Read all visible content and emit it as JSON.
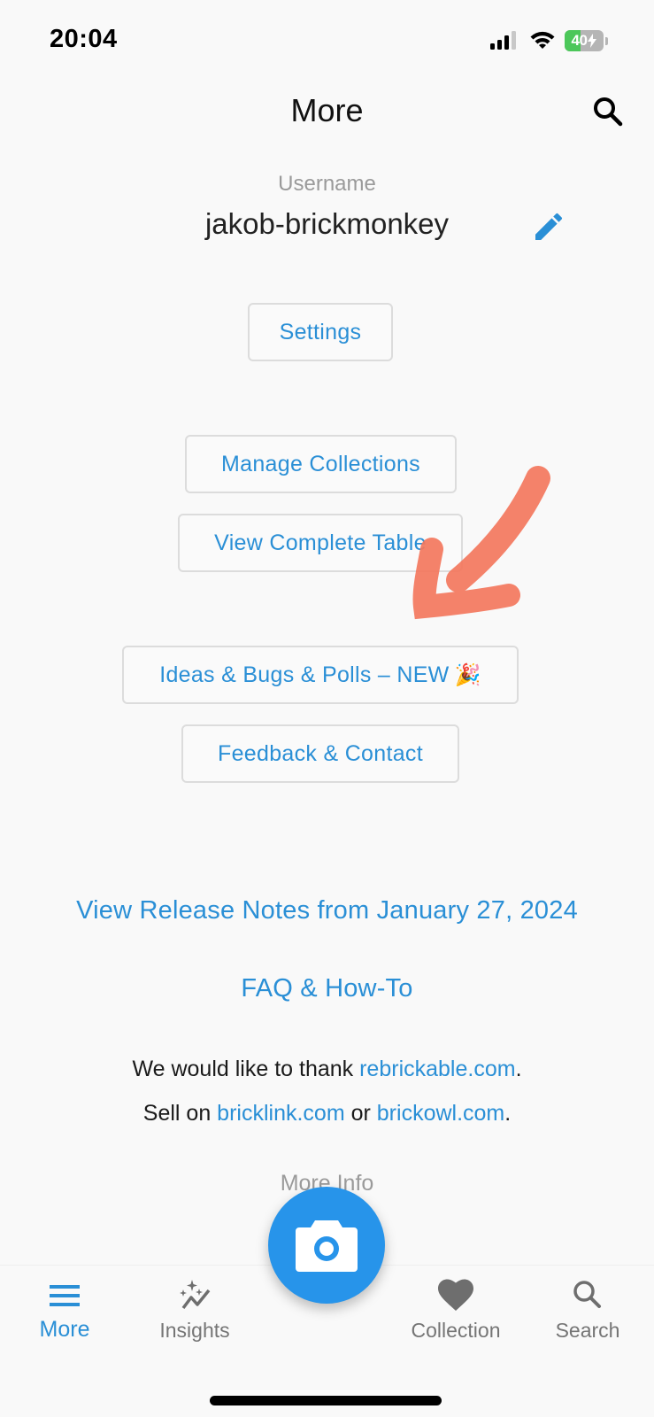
{
  "status_bar": {
    "time": "20:04",
    "battery_percent": "40",
    "battery_level": 0.4,
    "charging": true,
    "icons": [
      "cellular-signal-icon",
      "wifi-icon",
      "battery-icon"
    ]
  },
  "nav": {
    "title": "More",
    "search_icon": "search-icon"
  },
  "profile": {
    "username_label": "Username",
    "username": "jakob-brickmonkey",
    "edit_icon": "pencil-icon"
  },
  "buttons": {
    "settings": "Settings",
    "manage_collections": "Manage Collections",
    "view_complete_table": "View Complete Table",
    "ideas_bugs_polls": "Ideas & Bugs & Polls – NEW",
    "ideas_emoji": "🎉",
    "feedback_contact": "Feedback & Contact"
  },
  "links": {
    "release_notes": "View Release Notes from January 27, 2024",
    "faq": "FAQ & How-To"
  },
  "credits": {
    "thank_prefix": "We would like to thank ",
    "thank_link": "rebrickable.com",
    "thank_suffix": ".",
    "sell_prefix": "Sell on ",
    "sell_link_1": "bricklink.com",
    "sell_middle": " or ",
    "sell_link_2": "brickowl.com",
    "sell_suffix": "."
  },
  "more_info": "More Info",
  "annotation": {
    "type": "hand-drawn arrow",
    "color": "#f4785e"
  },
  "tab_bar": {
    "active": "More",
    "accent_color": "#2a8fd6",
    "items": [
      {
        "label": "More",
        "icon": "menu-icon"
      },
      {
        "label": "Insights",
        "icon": "insights-icon"
      },
      {
        "label": "",
        "icon": "camera-icon"
      },
      {
        "label": "Collection",
        "icon": "heart-icon"
      },
      {
        "label": "Search",
        "icon": "search-icon"
      }
    ]
  }
}
